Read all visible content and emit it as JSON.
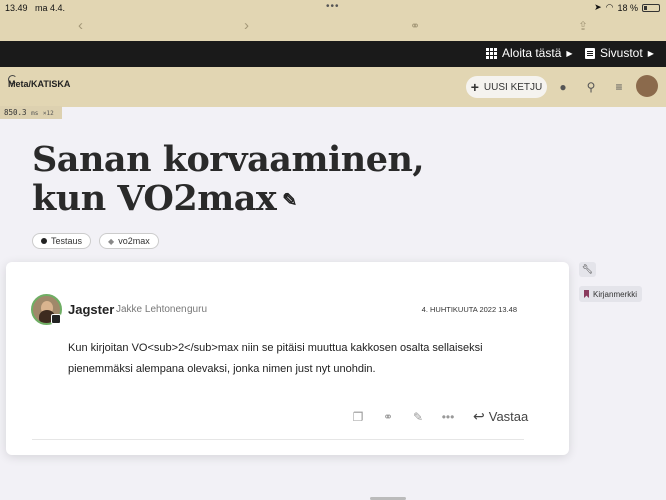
{
  "status": {
    "time": "13.49",
    "date": "ma 4.4.",
    "dots": "•••",
    "battery": "18 %"
  },
  "topbar": {
    "start_label": "Aloita tästä",
    "pages_label": "Sivustot"
  },
  "site": {
    "logo_text": "Meta/KATISKA",
    "new_topic_label": "UUSI KETJU"
  },
  "timing": {
    "ms": "850.3",
    "unit": "ms",
    "count": "×12"
  },
  "topic": {
    "title": "Sanan korvaaminen, kun VO2max",
    "tags": [
      "Testaus",
      "vo2max"
    ]
  },
  "rail": {
    "bookmark_label": "Kirjanmerkki"
  },
  "post": {
    "username": "Jagster",
    "full_name": "Jakke Lehtonen",
    "user_title": "guru",
    "date": "4. HUHTIKUUTA 2022 13.48",
    "body": "Kun kirjoitan VO<sub>2</sub>max niin se pitäisi muuttua kakkosen osalta sellaiseksi pienemmäksi alempana olevaksi, jonka nimen just nyt unohdin.",
    "reply_label": "Vastaa"
  },
  "colors": {
    "header_bg": "#e2d6b3",
    "topbar_bg": "#1a1a1a",
    "page_bg": "#f2f1f6"
  }
}
